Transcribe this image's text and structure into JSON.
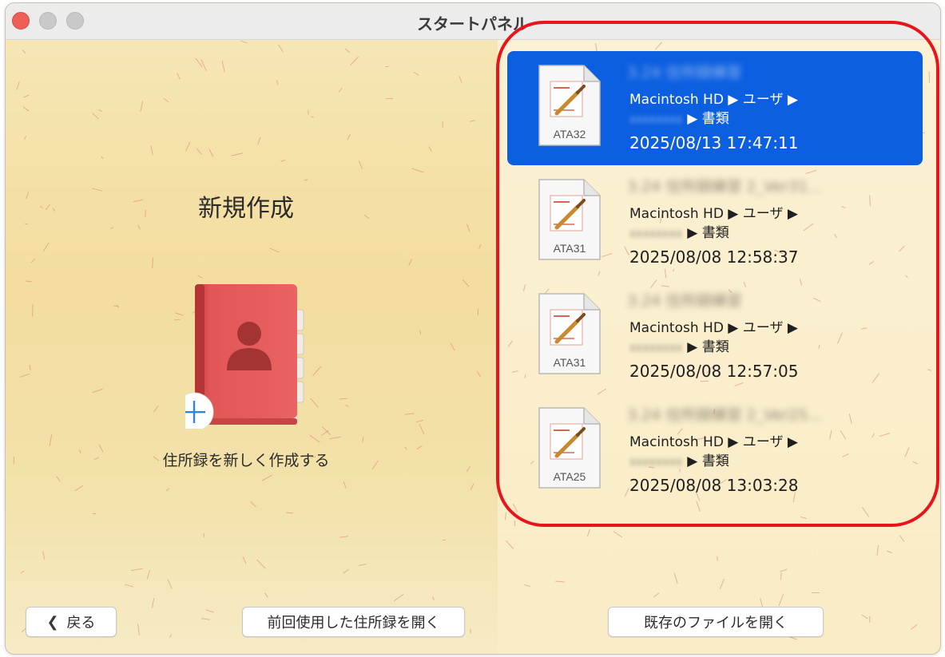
{
  "window": {
    "title": "スタートパネル"
  },
  "left_panel": {
    "heading": "新規作成",
    "caption": "住所録を新しく作成する"
  },
  "buttons": {
    "back_label": "戻る",
    "open_previous_label": "前回使用した住所録を開く",
    "open_existing_label": "既存のファイルを開く"
  },
  "recent_files": [
    {
      "name": "3.24 住所録練習",
      "badge": "ATA32",
      "path_line1": "Macintosh HD ▶ ユーザ ▶",
      "user": "xxxxxxxx",
      "path_line2": "▶ 書類",
      "date": "2025/08/13 17:47:11",
      "selected": true
    },
    {
      "name": "3.24 住所録練習 2_Ver31...",
      "badge": "ATA31",
      "path_line1": "Macintosh HD ▶ ユーザ ▶",
      "user": "xxxxxxxx",
      "path_line2": "▶ 書類",
      "date": "2025/08/08 12:58:37",
      "selected": false
    },
    {
      "name": "3.24 住所録練習",
      "badge": "ATA31",
      "path_line1": "Macintosh HD ▶ ユーザ ▶",
      "user": "xxxxxxxx",
      "path_line2": "▶ 書類",
      "date": "2025/08/08 12:57:05",
      "selected": false
    },
    {
      "name": "3.24 住所録練習 2_Ver25...",
      "badge": "ATA25",
      "path_line1": "Macintosh HD ▶ ユーザ ▶",
      "user": "xxxxxxxx",
      "path_line2": "▶ 書類",
      "date": "2025/08/08 13:03:28",
      "selected": false
    }
  ],
  "colors": {
    "selection": "#0c5fe0",
    "highlight_ring": "#e8141b",
    "book": "#e05353"
  },
  "icons": {
    "book": "address-book-icon",
    "plus": "plus-icon",
    "file": "document-icon"
  }
}
